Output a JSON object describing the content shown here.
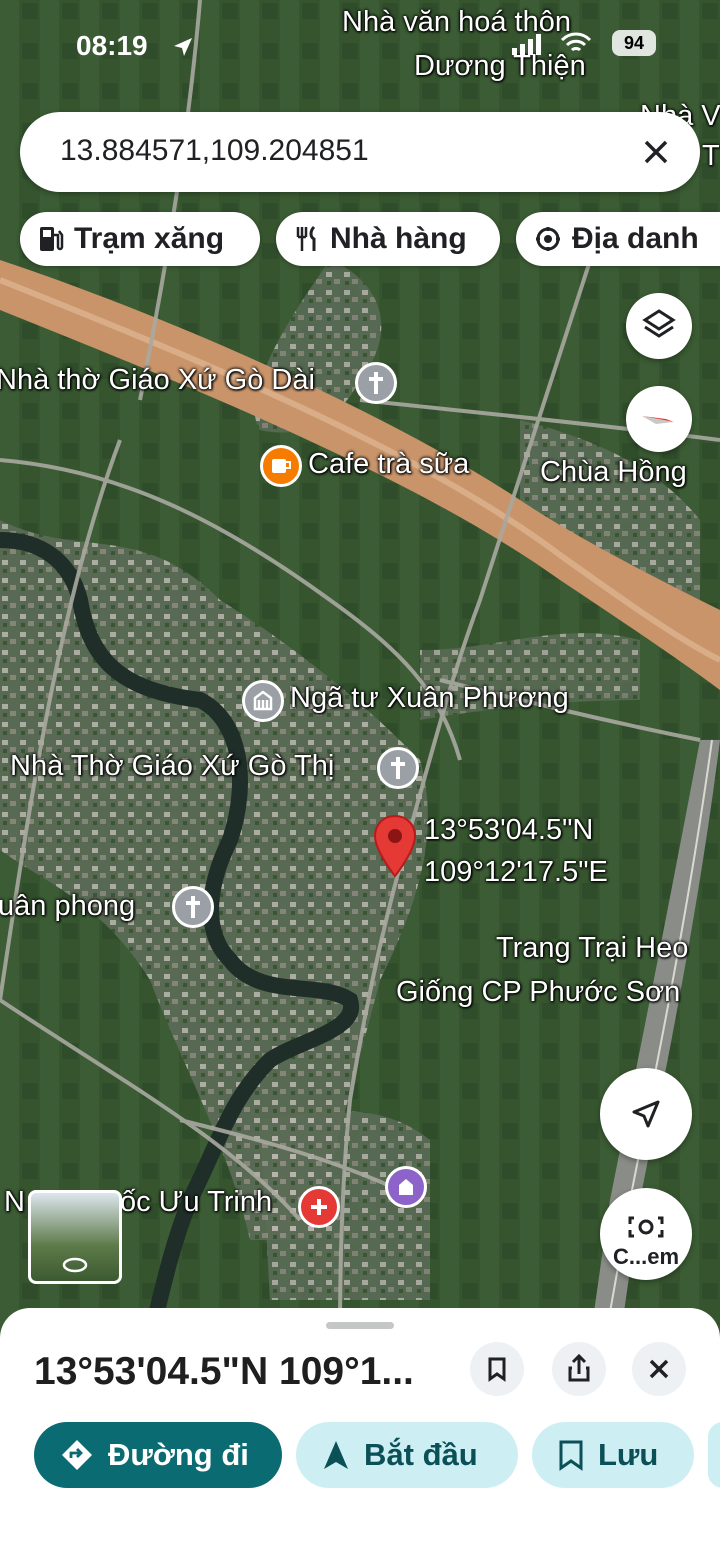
{
  "status_bar": {
    "time": "08:19",
    "battery": "94"
  },
  "search": {
    "value": "13.884571,109.204851"
  },
  "chips": [
    {
      "label": "Trạm xăng",
      "icon": "gas-station-icon"
    },
    {
      "label": "Nhà hàng",
      "icon": "restaurant-icon"
    },
    {
      "label": "Địa danh",
      "icon": "landmark-icon"
    }
  ],
  "map": {
    "labels": {
      "nha_van_hoa_1": "Nhà văn hoá thôn",
      "nha_van_hoa_2": "Dương Thiện",
      "edge_top_right_1": "Nhà V",
      "edge_top_right_2": "c T",
      "nha_tho_go_dai": "Nhà thờ Giáo Xứ Gò Dài",
      "cafe": "Cafe trà sữa",
      "chua_hong": "Chùa Hồng",
      "nga_tu": "Ngã tư Xuân Phương",
      "nha_tho_go_thi": "Nhà Thờ Giáo Xứ Gò Thị",
      "pin_lat": "13°53'04.5\"N",
      "pin_lng": "109°12'17.5\"E",
      "xuan_phong": "uân phong",
      "trang_trai_1": "Trang Trại Heo",
      "trang_trai_2": "Giống CP Phước Sơn",
      "uu_trinh_prefix": "N",
      "uu_trinh": "ốc Ưu Trinh"
    },
    "colors": {
      "pin": "#e53935",
      "cafe": "#f57c00",
      "church": "#9aa0a6",
      "attraction": "#8e63c9",
      "medical": "#e53935"
    }
  },
  "controls": {
    "camera_label": "C...em"
  },
  "sheet": {
    "title": "13°53'04.5\"N 109°1...",
    "actions": [
      {
        "label": "Đường đi",
        "primary": true
      },
      {
        "label": "Bắt đầu",
        "primary": false
      },
      {
        "label": "Lưu",
        "primary": false
      }
    ]
  }
}
